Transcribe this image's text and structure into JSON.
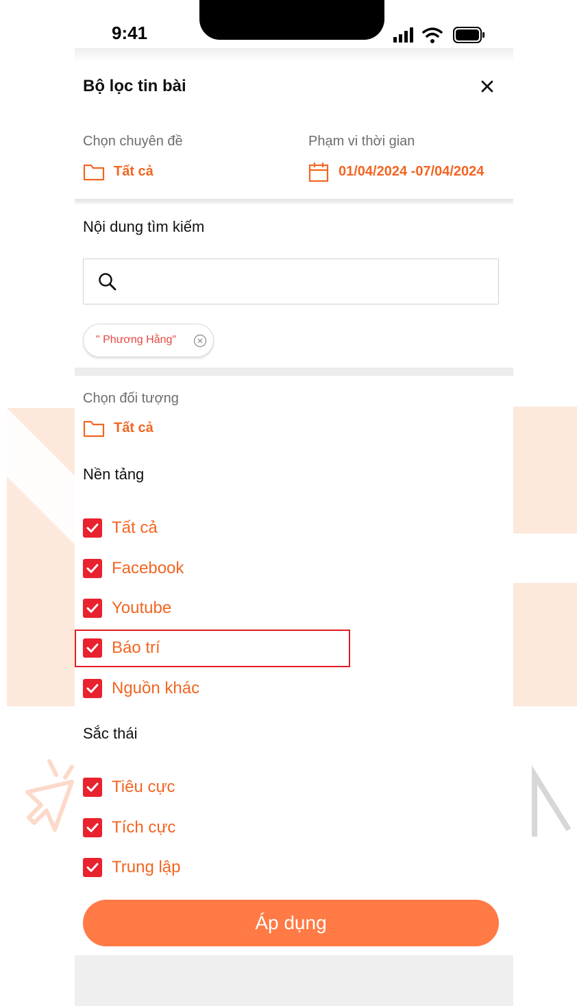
{
  "status_bar": {
    "time": "9:41"
  },
  "sheet": {
    "title": "Bộ lọc tin bài"
  },
  "topic": {
    "label": "Chọn chuyên đề",
    "value": "Tất cả"
  },
  "time_range": {
    "label": "Phạm vi thời gian",
    "value": "01/04/2024 -07/04/2024"
  },
  "search": {
    "title": "Nội dung tìm kiếm",
    "value": "",
    "chip": "\" Phương Hằng\""
  },
  "audience": {
    "label": "Chọn đối tượng",
    "value": "Tất cả"
  },
  "platform": {
    "title": "Nền tảng",
    "items": [
      {
        "label": "Tất cả",
        "checked": true
      },
      {
        "label": "Facebook",
        "checked": true
      },
      {
        "label": "Youtube",
        "checked": true
      },
      {
        "label": "Báo trí",
        "checked": true
      },
      {
        "label": "Nguồn khác",
        "checked": true
      }
    ]
  },
  "sentiment": {
    "title": "Sắc thái",
    "items": [
      {
        "label": "Tiêu cực",
        "checked": true
      },
      {
        "label": "Tích cực",
        "checked": true
      },
      {
        "label": "Trung lập",
        "checked": true
      }
    ]
  },
  "apply_button": {
    "label": "Áp dụng"
  },
  "colors": {
    "accent": "#f26522",
    "checkbox": "#e8222f",
    "button": "#ff7a45",
    "chip_text": "#e8463f"
  }
}
